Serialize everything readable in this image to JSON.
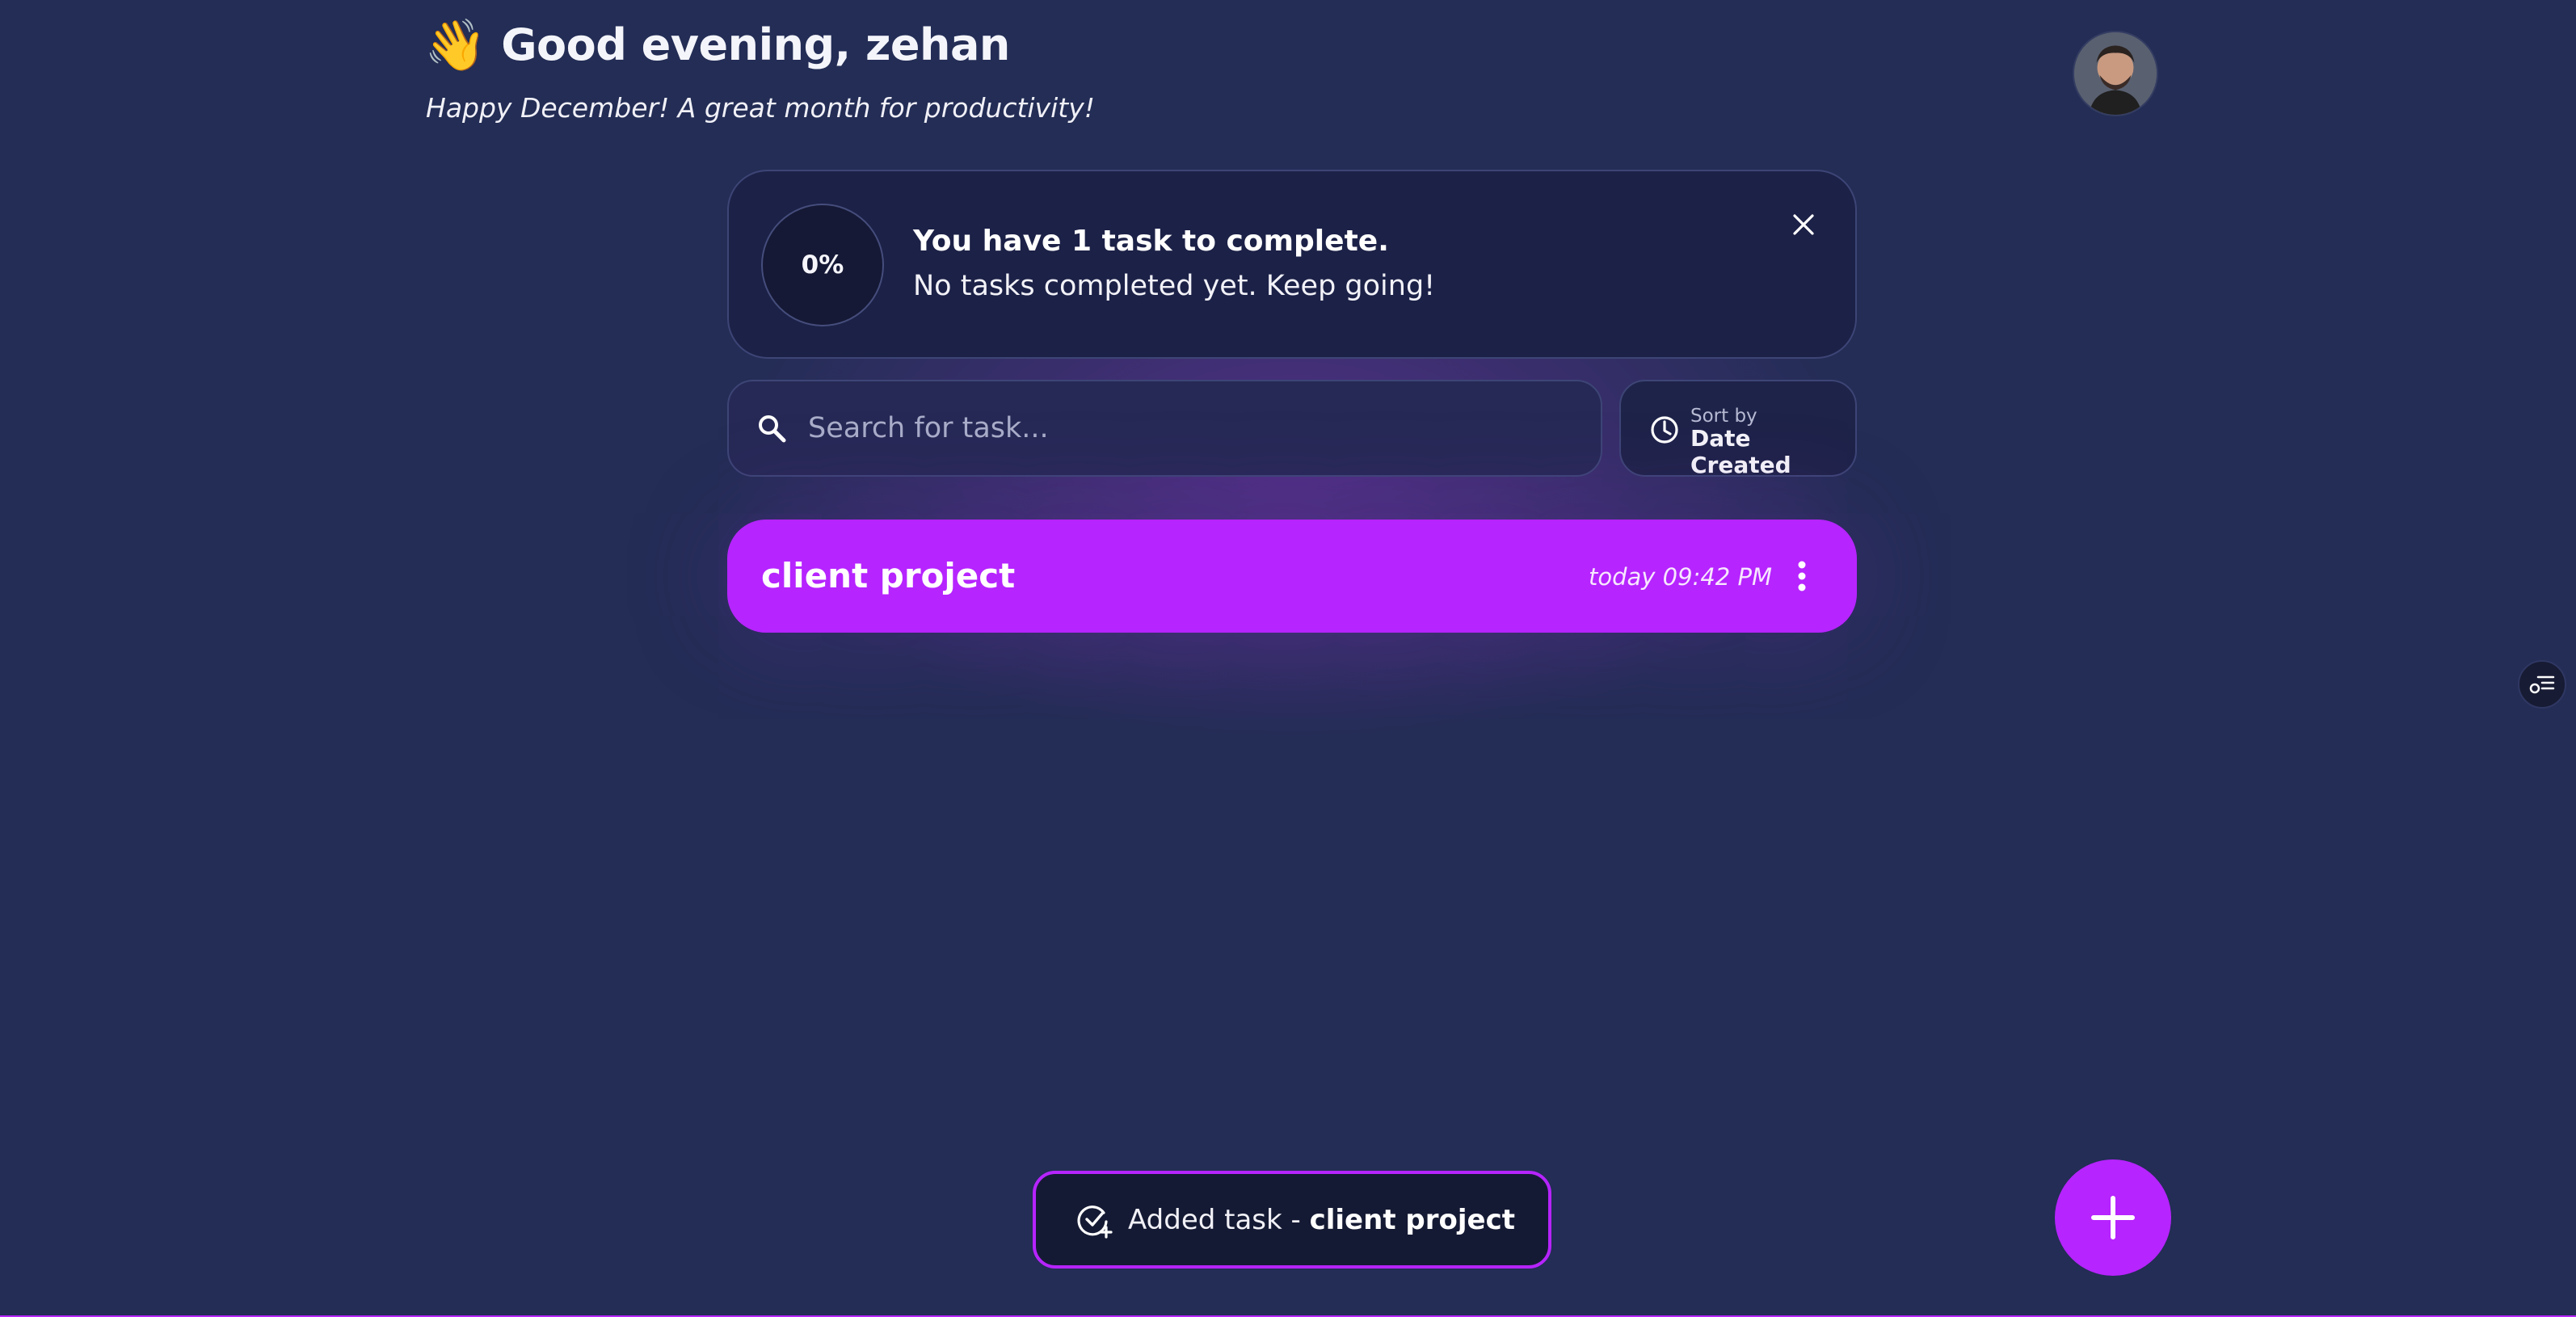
{
  "header": {
    "wave_emoji": "👋",
    "greeting": "Good evening, zehan",
    "subtitle": "Happy December! A great month for productivity!"
  },
  "progress_card": {
    "percent_label": "0%",
    "percent_value": 0,
    "title": "You have 1 task to complete.",
    "description": "No tasks completed yet. Keep going!"
  },
  "search": {
    "placeholder": "Search for task...",
    "value": ""
  },
  "sort": {
    "label": "Sort by",
    "value": "Date Created"
  },
  "tasks": [
    {
      "title": "client project",
      "time": "today 09:42 PM",
      "color": "#b624ff"
    }
  ],
  "toast": {
    "prefix": "Added task - ",
    "task_name": "client project"
  },
  "colors": {
    "background": "#232d55",
    "accent": "#b624ff",
    "card": "#1c2147"
  },
  "icons": {
    "wave": "wave-icon",
    "close": "close-icon",
    "search": "search-icon",
    "clock": "clock-icon",
    "more": "more-vertical-icon",
    "add": "plus-icon",
    "task_added": "check-plus-icon",
    "side_toggle": "list-settings-icon"
  }
}
